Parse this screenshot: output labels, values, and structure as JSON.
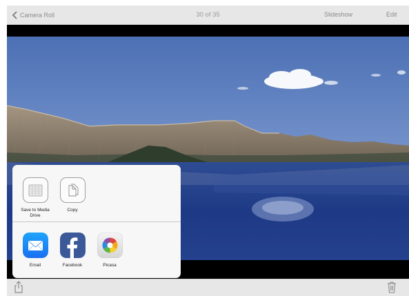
{
  "navbar": {
    "back_label": "Camera Roll",
    "title": "30 of 35",
    "slideshow_label": "Slideshow",
    "edit_label": "Edit"
  },
  "share_sheet": {
    "actions": [
      {
        "label": "Save to Media Drive",
        "icon": "media-drive-icon"
      },
      {
        "label": "Copy",
        "icon": "copy-icon"
      }
    ],
    "apps": [
      {
        "label": "Email",
        "icon": "mail-icon",
        "color": "#1d8cf8"
      },
      {
        "label": "Facebook",
        "icon": "facebook-icon",
        "color": "#3b5998"
      },
      {
        "label": "Picasa",
        "icon": "picasa-icon",
        "color": "#e8e8e8"
      }
    ]
  },
  "toolbar": {
    "share_icon": "share-icon",
    "trash_icon": "trash-icon"
  },
  "colors": {
    "bar": "#e7e7e7",
    "bar_text": "#8a8a8a",
    "sky_top": "#4f73b6",
    "sky_bottom": "#a8bde0",
    "lake": "#1f3d8a"
  }
}
